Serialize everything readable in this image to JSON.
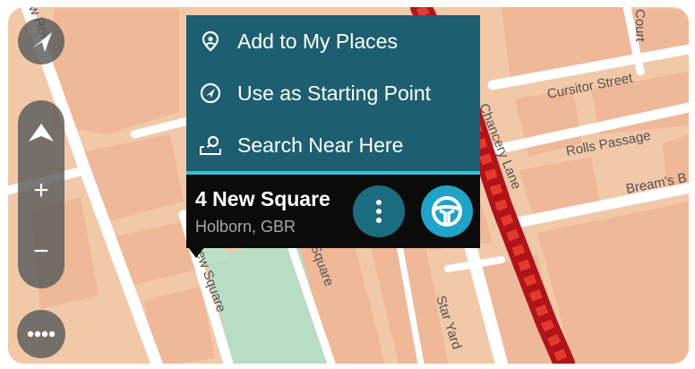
{
  "menu": {
    "items": [
      {
        "label": "Add to My Places",
        "icon": "place-pin-icon"
      },
      {
        "label": "Use as Starting Point",
        "icon": "navigation-arrow-icon"
      },
      {
        "label": "Search Near Here",
        "icon": "search-nearby-icon"
      }
    ]
  },
  "location": {
    "name": "4 New Square",
    "subtitle": "Holborn, GBR"
  },
  "map": {
    "streets": {
      "cursitor": "Cursitor Street",
      "rolls": "Rolls Passage",
      "bream": "Bream's B",
      "chancery": "Chancery Lane",
      "new_square_1": "New Square",
      "new_square_2": "Square",
      "star_yard": "Star Yard",
      "court": "Court",
      "row": "w Row"
    },
    "colors": {
      "land": "#f2c9a8",
      "building": "#f0b896",
      "road": "#ffffff",
      "green": "#b8dcc4",
      "traffic": "#d81e1e"
    }
  },
  "controls": {
    "compass_icon": "compass-arrow-icon",
    "zoom_in_symbol": "+",
    "zoom_out_symbol": "−",
    "tilt_icon": "chevron-up-icon",
    "main_menu_icon": "ellipsis-icon"
  },
  "colors": {
    "menu_bg": "#1d5e70",
    "menu_divider": "#36bfd6",
    "card_bg": "#0b0b0b",
    "drive_button": "#1fa3c7"
  }
}
